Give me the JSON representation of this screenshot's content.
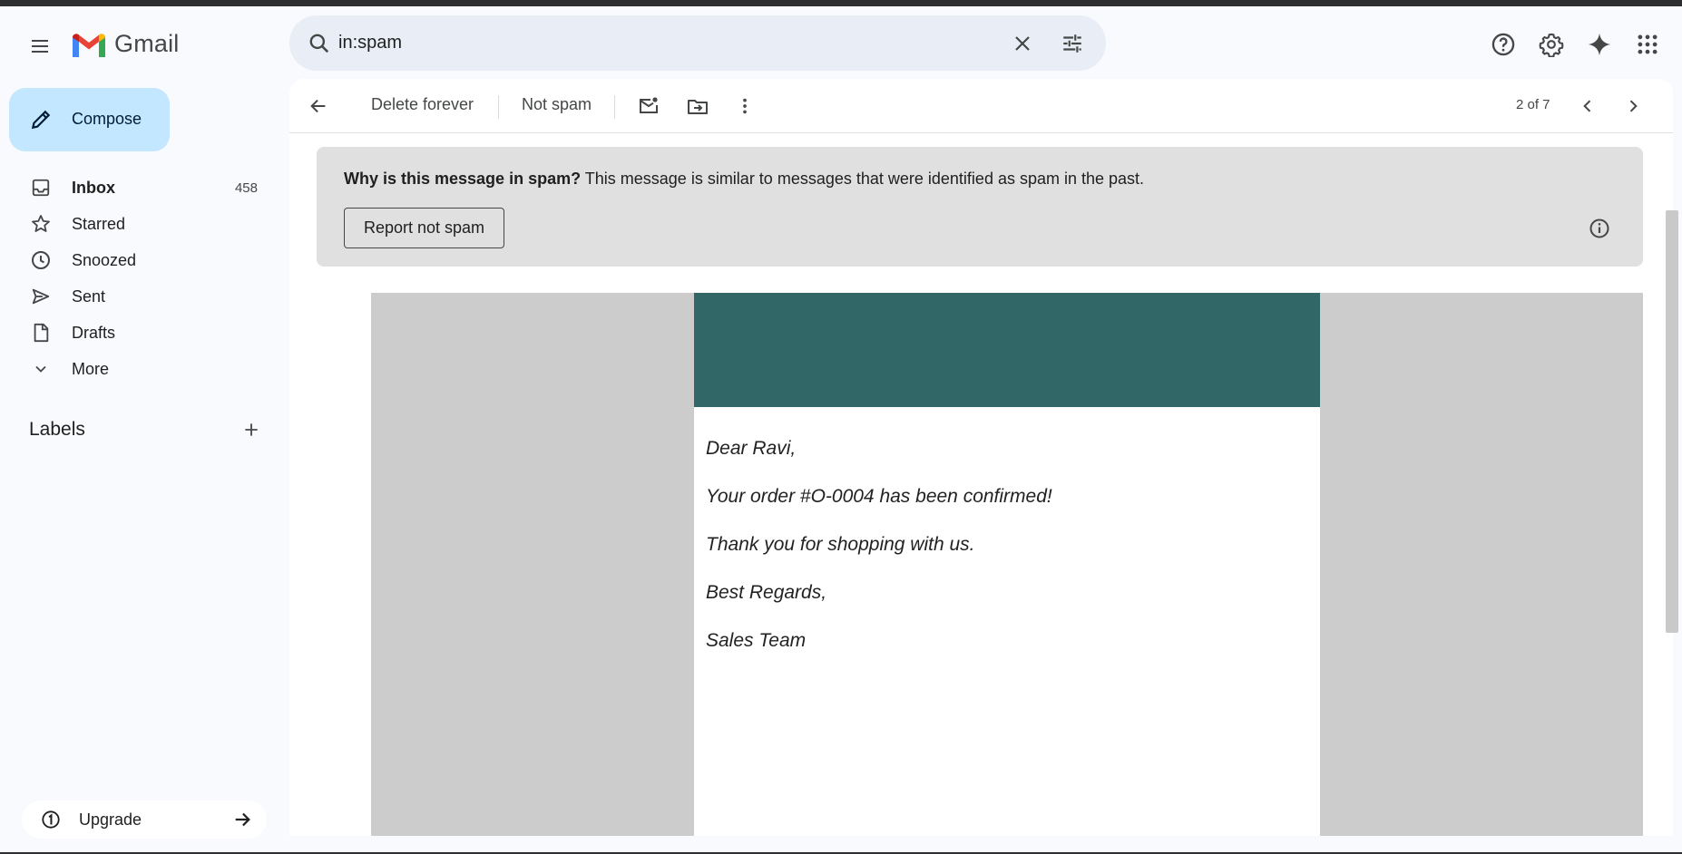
{
  "app": {
    "name": "Gmail"
  },
  "search": {
    "value": "in:spam"
  },
  "compose": {
    "label": "Compose"
  },
  "sidebar": {
    "items": [
      {
        "label": "Inbox",
        "count": "458",
        "icon": "inbox-icon"
      },
      {
        "label": "Starred",
        "icon": "star-icon"
      },
      {
        "label": "Snoozed",
        "icon": "clock-icon"
      },
      {
        "label": "Sent",
        "icon": "send-icon"
      },
      {
        "label": "Drafts",
        "icon": "draft-icon"
      },
      {
        "label": "More",
        "icon": "chevron-down-icon"
      }
    ],
    "labels_title": "Labels",
    "upgrade_label": "Upgrade"
  },
  "toolbar": {
    "delete_label": "Delete forever",
    "not_spam_label": "Not spam",
    "pager": "2 of 7"
  },
  "spam_banner": {
    "title": "Why is this message in spam?",
    "text": " This message is similar to messages that were identified as spam in the past.",
    "report_button": "Report not spam"
  },
  "email": {
    "header_color": "#326767",
    "lines": [
      "Dear Ravi,",
      "Your order #O-0004 has been confirmed!",
      "Thank you for shopping with us.",
      "Best Regards,",
      "Sales Team"
    ]
  },
  "colors": {
    "compose_bg": "#c2e7ff",
    "search_bg": "#e9eef6",
    "banner_bg": "#e0e0e0"
  }
}
